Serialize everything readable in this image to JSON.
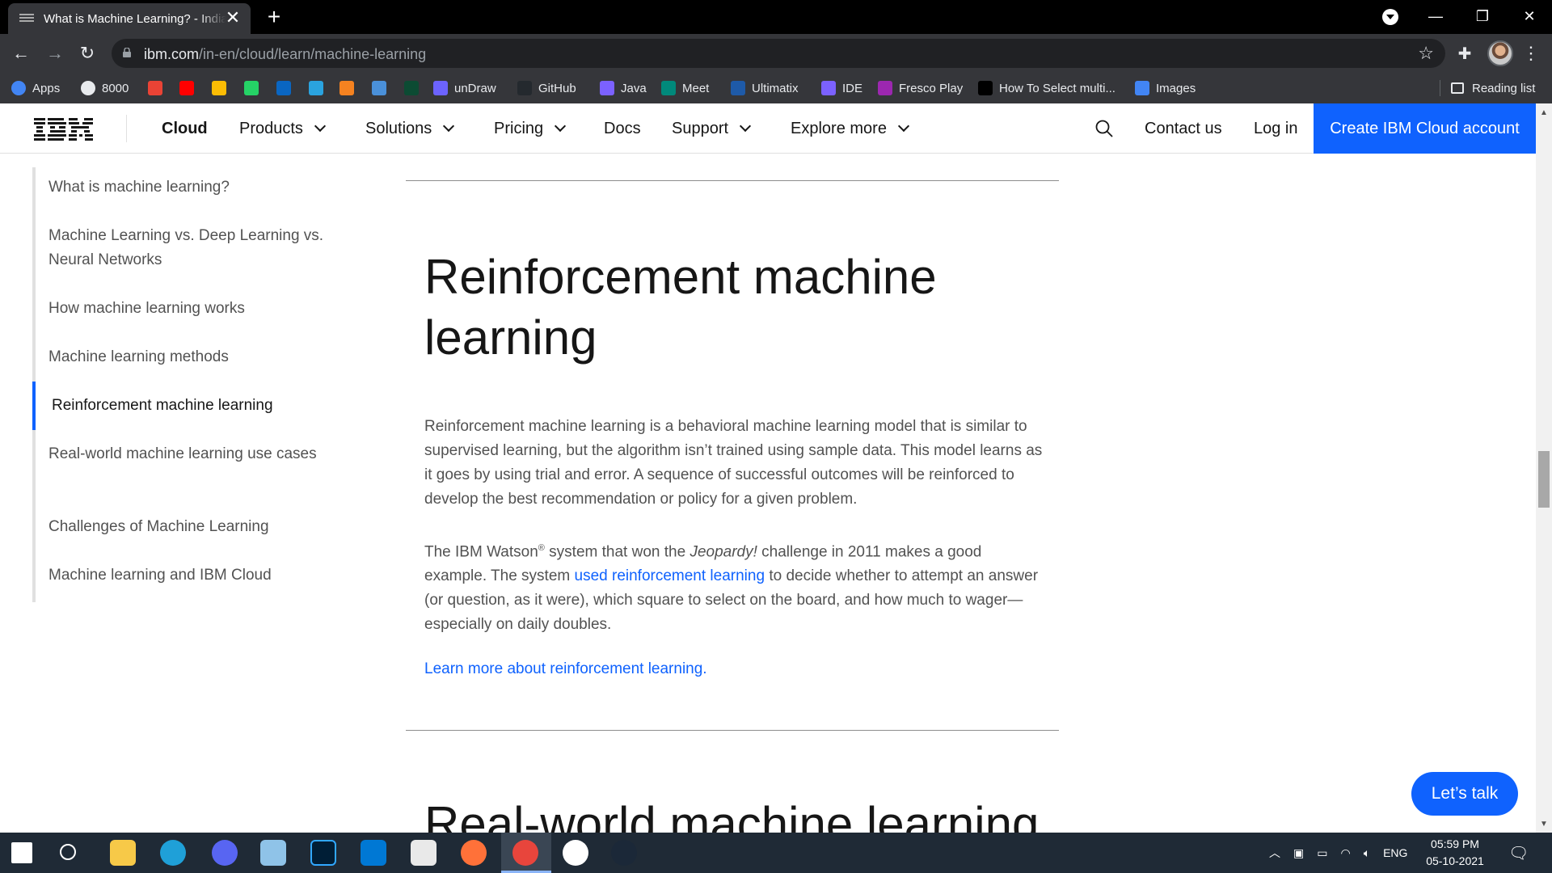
{
  "browser": {
    "tab_title": "What is Machine Learning? - India | IBM",
    "url_domain": "ibm.com",
    "url_path": "/in-en/cloud/learn/machine-learning",
    "new_tab": "+",
    "close": "✕",
    "bookmarks": [
      {
        "label": "Apps",
        "icon": "apps-grid-icon",
        "color": "#4285f4"
      },
      {
        "label": "8000",
        "icon": "globe-icon",
        "color": "#e8eaed"
      },
      {
        "label": "",
        "icon": "gmail-icon",
        "color": "#ea4335"
      },
      {
        "label": "",
        "icon": "youtube-icon",
        "color": "#ff0000"
      },
      {
        "label": "",
        "icon": "drive-icon",
        "color": "#fbbc04"
      },
      {
        "label": "",
        "icon": "whatsapp-icon",
        "color": "#25d366"
      },
      {
        "label": "",
        "icon": "linkedin-icon",
        "color": "#0a66c2"
      },
      {
        "label": "",
        "icon": "telegram-icon",
        "color": "#2aa3df"
      },
      {
        "label": "",
        "icon": "in-icon",
        "color": "#f58220"
      },
      {
        "label": "",
        "icon": "t-icon",
        "color": "#4a90d9"
      },
      {
        "label": "",
        "icon": "dj-icon",
        "color": "#0c4b33"
      },
      {
        "label": "unDraw",
        "icon": "undraw-icon",
        "color": "#6c63ff"
      },
      {
        "label": "GitHub",
        "icon": "github-icon",
        "color": "#24292e"
      },
      {
        "label": "Java",
        "icon": "bolt-icon",
        "color": "#7b61ff"
      },
      {
        "label": "Meet",
        "icon": "meet-icon",
        "color": "#00897b"
      },
      {
        "label": "Ultimatix",
        "icon": "tata-icon",
        "color": "#1e5aa8"
      },
      {
        "label": "IDE",
        "icon": "bolt-icon",
        "color": "#7b61ff"
      },
      {
        "label": "Fresco Play",
        "icon": "fresco-icon",
        "color": "#9c27b0"
      },
      {
        "label": "How To Select multi...",
        "icon": "dev-icon",
        "color": "#000000"
      },
      {
        "label": "Images",
        "icon": "images-icon",
        "color": "#4285f4"
      }
    ],
    "reading_list": "Reading list"
  },
  "masthead": {
    "brand": "Cloud",
    "nav": [
      {
        "label": "Products",
        "dropdown": true
      },
      {
        "label": "Solutions",
        "dropdown": true
      },
      {
        "label": "Pricing",
        "dropdown": true
      },
      {
        "label": "Docs",
        "dropdown": false
      },
      {
        "label": "Support",
        "dropdown": true
      },
      {
        "label": "Explore more",
        "dropdown": true
      }
    ],
    "contact": "Contact us",
    "login": "Log in",
    "cta": "Create IBM Cloud account"
  },
  "toc": {
    "active_index": 4,
    "items": [
      {
        "label": "What is machine learning?"
      },
      {
        "label": "Machine Learning vs. Deep Learning vs. Neural Networks"
      },
      {
        "label": "How machine learning works"
      },
      {
        "label": "Machine learning methods"
      },
      {
        "label": "Reinforcement machine learning"
      },
      {
        "label": "Real-world machine learning use cases"
      },
      {
        "label": "Challenges of Machine Learning"
      },
      {
        "label": "Machine learning and IBM Cloud"
      }
    ]
  },
  "article": {
    "heading": "Reinforcement machine learning",
    "p1": "Reinforcement machine learning is a behavioral machine learning model that is similar to supervised learning, but the algorithm isn’t trained using sample data. This model learns as it goes by using trial and error. A sequence of successful outcomes will be reinforced to develop the best recommendation or policy for a given problem.",
    "p2_pre": "The IBM Watson",
    "p2_reg": "®",
    "p2_mid1": " system that won the ",
    "p2_em": "Jeopardy!",
    "p2_mid2": " challenge in 2011 makes a good example. The system ",
    "p2_link": "used reinforcement learning",
    "p2_post": " to decide whether to attempt an answer (or question, as it were), which square to select on the board, and how much to wager—especially on daily doubles.",
    "learn_more": "Learn more about reinforcement learning.",
    "next_heading": "Real-world machine learning"
  },
  "chat": {
    "label": "Let’s talk"
  },
  "taskbar": {
    "apps": [
      "windows-start-icon",
      "search-icon",
      "file-explorer-icon",
      "edge-icon",
      "discord-icon",
      "notepad-icon",
      "photoshop-icon",
      "vscode-icon",
      "paint-icon",
      "firefox-icon",
      "chrome-icon",
      "word-icon",
      "steam-icon"
    ],
    "lang": "ENG",
    "time": "05:59 PM",
    "date": "05-10-2021"
  },
  "colors": {
    "accent": "#0f62fe",
    "text": "#161616",
    "secondary": "#525252"
  }
}
